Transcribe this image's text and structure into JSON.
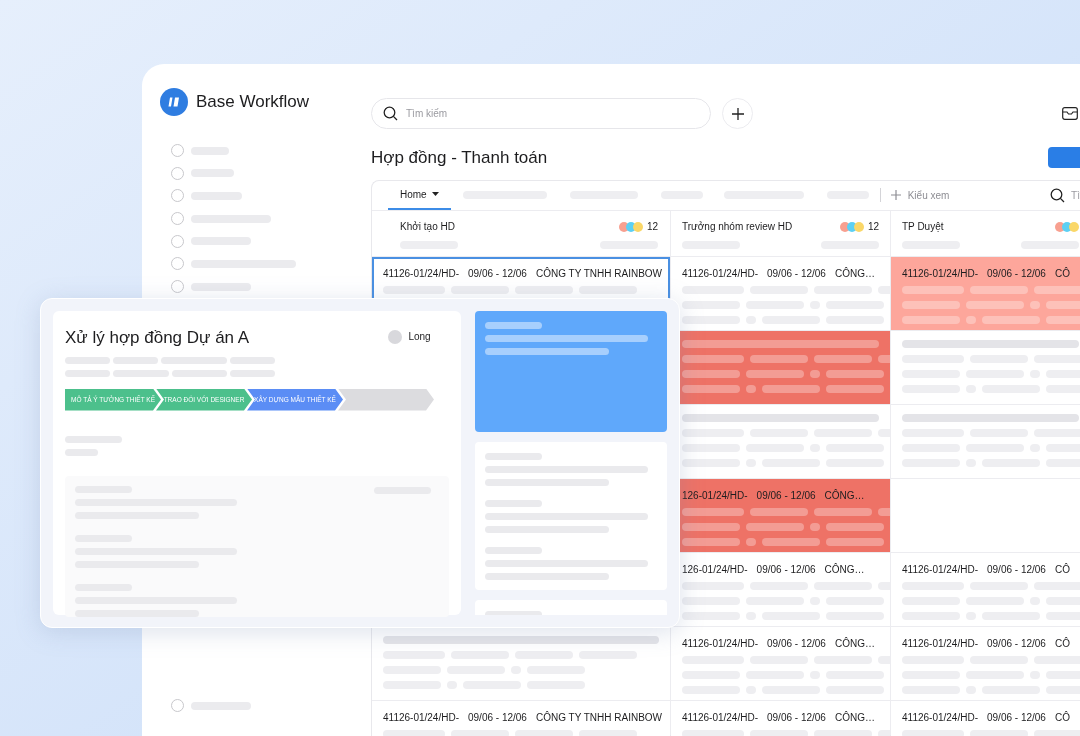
{
  "app": {
    "name": "Base Workflow"
  },
  "search": {
    "placeholder": "Tìm kiếm"
  },
  "page_title": "Hợp đồng - Thanh toán",
  "view_tabs": [
    {
      "label": "Home",
      "selected": true
    }
  ],
  "add_view": {
    "label": "Kiểu xem"
  },
  "board_search": {
    "placeholder": "Tì"
  },
  "columns": [
    {
      "title": "Khởi tạo HD",
      "count": "12",
      "cards": [
        {
          "kind": "record",
          "code": "41126-01/24/HD-",
          "dates": "09/06 - 12/06",
          "company": "CÔNG TY TNHH RAINBOW",
          "color": "#ffffff",
          "selected": true
        },
        {
          "kind": "skeleton",
          "color": "#ffffff",
          "selected": false
        },
        {
          "kind": "record",
          "code": "41126-01/24/HD-",
          "dates": "09/06 - 12/06",
          "company": "CÔNG TY TNHH RAINBOW",
          "color": "#ffffff",
          "selected": false
        }
      ]
    },
    {
      "title": "Trưởng nhóm review HD",
      "count": "12",
      "cards": [
        {
          "kind": "record",
          "code": "41126-01/24/HD-",
          "dates": "09/06 - 12/06",
          "company": "CÔNG…",
          "color": "#ffffff",
          "selected": false
        },
        {
          "kind": "skeleton",
          "color": "#ee7266",
          "selected": false
        },
        {
          "kind": "skeleton",
          "color": "#ffffff",
          "selected": false
        },
        {
          "kind": "record",
          "code": "126-01/24/HD-",
          "dates": "09/06 - 12/06",
          "company": "CÔNG…",
          "color": "#ee7266",
          "selected": false
        },
        {
          "kind": "record",
          "code": "126-01/24/HD-",
          "dates": "09/06 - 12/06",
          "company": "CÔNG…",
          "color": "#ffffff",
          "selected": false
        },
        {
          "kind": "record",
          "code": "41126-01/24/HD-",
          "dates": "09/06 - 12/06",
          "company": "CÔNG…",
          "color": "#ffffff",
          "selected": false
        },
        {
          "kind": "record",
          "code": "41126-01/24/HD-",
          "dates": "09/06 - 12/06",
          "company": "CÔNG…",
          "color": "#ffffff",
          "selected": false
        }
      ]
    },
    {
      "title": "TP Duyệt",
      "cards": [
        {
          "kind": "record",
          "code": "41126-01/24/HD-",
          "dates": "09/06 - 12/06",
          "company": "CÔ",
          "color": "#fda69b",
          "selected": false
        },
        {
          "kind": "skeleton",
          "color": "#ffffff",
          "selected": false
        },
        {
          "kind": "skeleton",
          "color": "#ffffff",
          "selected": false
        },
        {
          "kind": "empty",
          "color": "#ffffff",
          "selected": false
        },
        {
          "kind": "record",
          "code": "41126-01/24/HD-",
          "dates": "09/06 - 12/06",
          "company": "CÔ",
          "color": "#ffffff",
          "selected": false
        },
        {
          "kind": "record",
          "code": "41126-01/24/HD-",
          "dates": "09/06 - 12/06",
          "company": "CÔ",
          "color": "#ffffff",
          "selected": false
        },
        {
          "kind": "record",
          "code": "41126-01/24/HD-",
          "dates": "09/06 - 12/06",
          "company": "CÔ",
          "color": "#ffffff",
          "selected": false
        }
      ]
    }
  ],
  "task_panel": {
    "title": "Xử lý hợp đồng Dự án A",
    "assignee": "Long",
    "steps": [
      {
        "label": "MÔ TẢ Ý TƯỞNG THIẾT KẾ",
        "color": "#4cc08c"
      },
      {
        "label": "TRAO ĐỔI VỚI DESIGNER",
        "color": "#4cc08c"
      },
      {
        "label": "XÂY DỰNG MẪU THIẾT KẾ",
        "color": "#5b8df5"
      },
      {
        "color": "#dcdcdf"
      }
    ]
  }
}
